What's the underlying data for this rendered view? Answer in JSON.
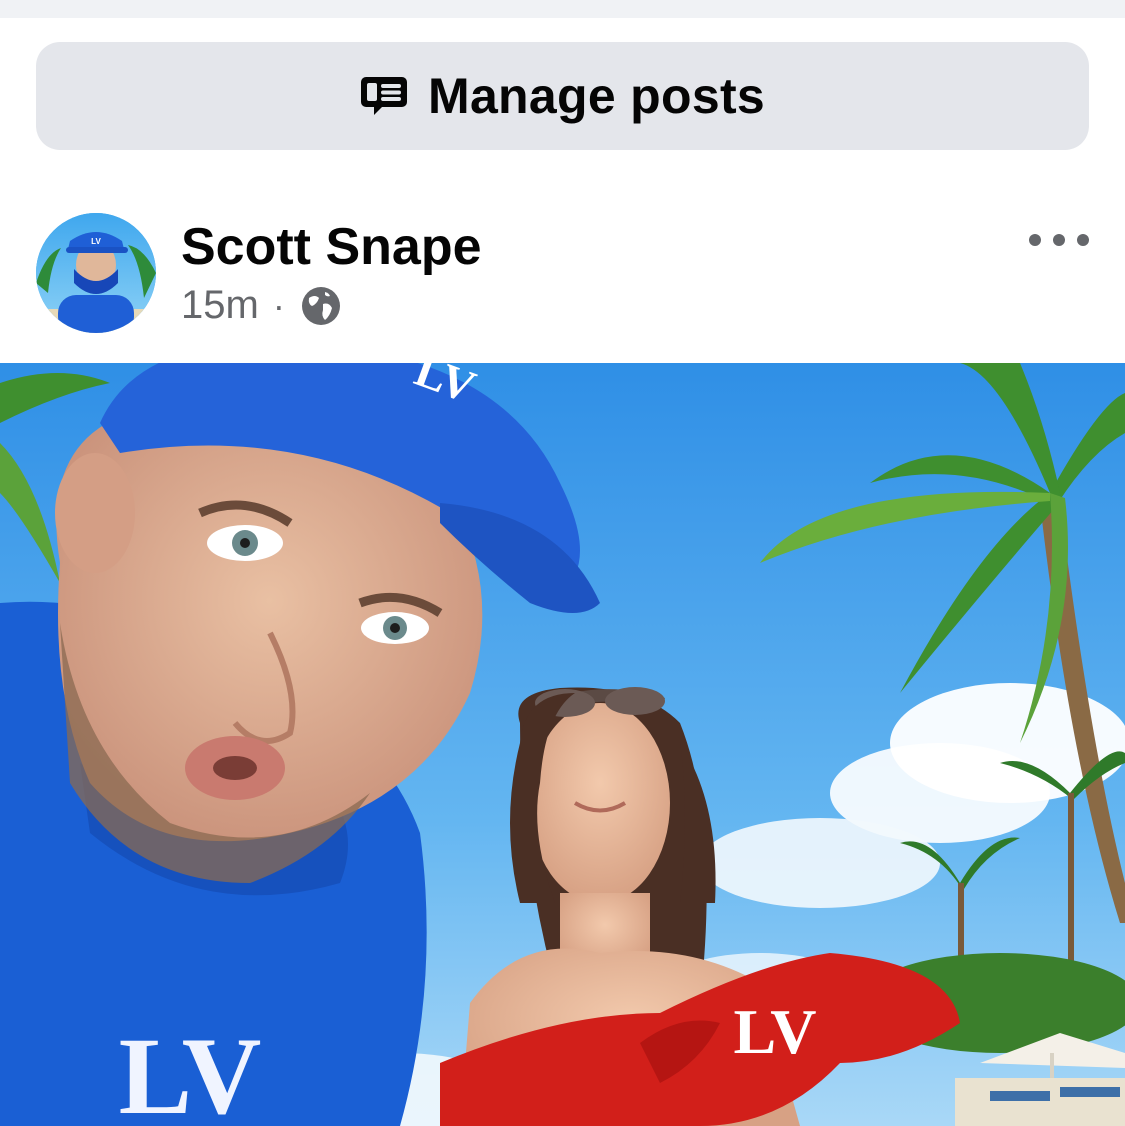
{
  "manage": {
    "label": "Manage posts",
    "icon": "manage-posts-icon"
  },
  "post": {
    "author": "Scott Snape",
    "time": "15m",
    "separator": "·",
    "audience_icon": "globe-icon",
    "more_icon": "more-options-icon",
    "photo_text_cap": "LV",
    "photo_text_dress": "LV",
    "photo_text_shirt": "LV"
  },
  "colors": {
    "button_bg": "#e4e6eb",
    "secondary_text": "#65676b",
    "strip_bg": "#f0f2f5"
  }
}
